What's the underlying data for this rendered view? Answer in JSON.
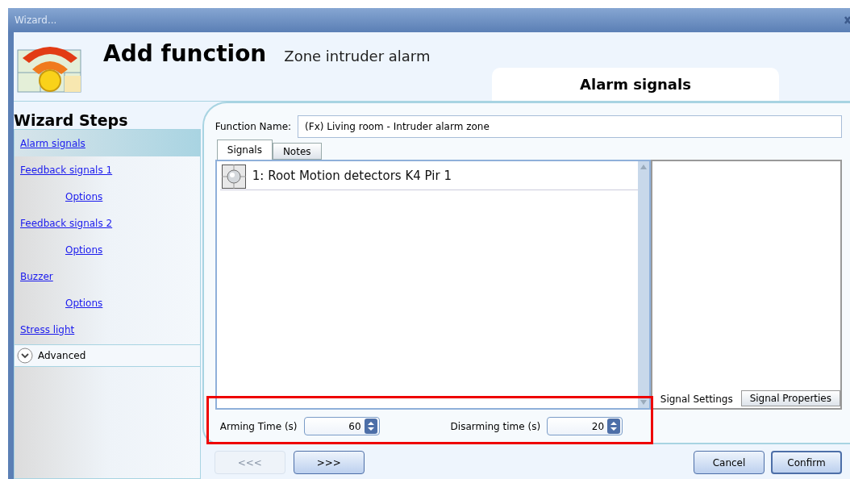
{
  "window": {
    "title": "Wizard..."
  },
  "header": {
    "title": "Add function",
    "subtitle": "Zone intruder alarm",
    "step_tab": "Alarm signals"
  },
  "sidebar": {
    "title": "Wizard Steps",
    "items": [
      {
        "label": "Alarm signals",
        "selected": true
      },
      {
        "label": "Feedback signals 1",
        "selected": false,
        "children": [
          {
            "label": "Options",
            "selected": false
          }
        ]
      },
      {
        "label": "Feedback signals 2",
        "selected": false,
        "children": [
          {
            "label": "Options",
            "selected": false
          }
        ]
      },
      {
        "label": "Buzzer",
        "selected": false,
        "children": [
          {
            "label": "Options",
            "selected": false
          }
        ]
      },
      {
        "label": "Stress light",
        "selected": false
      }
    ],
    "advanced": {
      "label": "Advanced",
      "expanded": false
    }
  },
  "form": {
    "function_name_label": "Function Name:",
    "function_name_value": "(Fx) Living room - Intruder alarm zone",
    "tabs": [
      {
        "label": "Signals",
        "selected": true
      },
      {
        "label": "Notes",
        "selected": false
      }
    ],
    "signals": [
      {
        "label": "1: Root Motion detectors K4 Pir 1"
      }
    ],
    "side_tabs": [
      {
        "label": "Signal Settings",
        "selected": true
      },
      {
        "label": "Signal Properties",
        "selected": false
      }
    ],
    "arming": {
      "label": "Arming Time (s)",
      "value": "60"
    },
    "disarming": {
      "label": "Disarming time (s)",
      "value": "20"
    }
  },
  "buttons": {
    "back": {
      "label": "<<<",
      "disabled": true
    },
    "next": {
      "label": ">>>",
      "disabled": false
    },
    "cancel": {
      "label": "Cancel"
    },
    "confirm": {
      "label": "Confirm"
    }
  }
}
